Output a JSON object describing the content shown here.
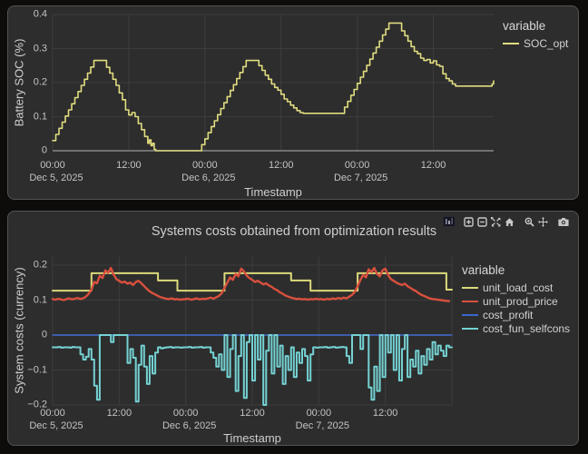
{
  "modebar": {
    "icons": [
      "plotly-logo",
      "zoom-in",
      "zoom-out",
      "autoscale",
      "reset-axes",
      "zoom",
      "pan",
      "camera"
    ]
  },
  "chart_data": [
    {
      "type": "line",
      "title": "",
      "xlabel": "Timestamp",
      "ylabel": "Battery SOC (%)",
      "legend_title": "variable",
      "legend_position": "right",
      "grid": true,
      "xlim_hours": [
        0,
        69.5
      ],
      "ylim": [
        0,
        0.4
      ],
      "x_epoch": "Dec 5, 2025 00:00",
      "x_ticks": [
        {
          "t": 0,
          "label": "00:00",
          "date": "Dec 5, 2025"
        },
        {
          "t": 12,
          "label": "12:00"
        },
        {
          "t": 24,
          "label": "00:00",
          "date": "Dec 6, 2025"
        },
        {
          "t": 36,
          "label": "12:00"
        },
        {
          "t": 48,
          "label": "00:00",
          "date": "Dec 7, 2025"
        },
        {
          "t": 60,
          "label": "12:00"
        }
      ],
      "y_ticks": [
        {
          "v": 0,
          "label": "0"
        },
        {
          "v": 0.1,
          "label": "0.1"
        },
        {
          "v": 0.2,
          "label": "0.2"
        },
        {
          "v": 0.3,
          "label": "0.3"
        },
        {
          "v": 0.4,
          "label": "0.4"
        }
      ],
      "series": [
        {
          "name": "SOC_opt",
          "color": "#e0dd80",
          "width": 1.6,
          "mode": "step",
          "points": [
            [
              0,
              0.03
            ],
            [
              0.5,
              0.048
            ],
            [
              1,
              0.066
            ],
            [
              1.5,
              0.084
            ],
            [
              2,
              0.102
            ],
            [
              2.5,
              0.12
            ],
            [
              3,
              0.138
            ],
            [
              3.5,
              0.156
            ],
            [
              4,
              0.174
            ],
            [
              4.5,
              0.192
            ],
            [
              5,
              0.21
            ],
            [
              5.5,
              0.228
            ],
            [
              6,
              0.246
            ],
            [
              6.5,
              0.265
            ],
            [
              8,
              0.265
            ],
            [
              8.5,
              0.245
            ],
            [
              9,
              0.228
            ],
            [
              9.5,
              0.21
            ],
            [
              10,
              0.192
            ],
            [
              10.5,
              0.17
            ],
            [
              11,
              0.15
            ],
            [
              11.5,
              0.12
            ],
            [
              12,
              0.105
            ],
            [
              12.5,
              0.112
            ],
            [
              13,
              0.1
            ],
            [
              13.5,
              0.08
            ],
            [
              14,
              0.062
            ],
            [
              14.5,
              0.042
            ],
            [
              15,
              0.022
            ],
            [
              15.25,
              0.032
            ],
            [
              15.5,
              0.015
            ],
            [
              15.75,
              0.022
            ],
            [
              16,
              0.004
            ],
            [
              16.25,
              0
            ],
            [
              23,
              0
            ],
            [
              23.5,
              0.018
            ],
            [
              24,
              0.035
            ],
            [
              24.5,
              0.053
            ],
            [
              25,
              0.071
            ],
            [
              25.5,
              0.088
            ],
            [
              26,
              0.106
            ],
            [
              26.5,
              0.124
            ],
            [
              27,
              0.141
            ],
            [
              27.5,
              0.159
            ],
            [
              28,
              0.177
            ],
            [
              28.5,
              0.194
            ],
            [
              29,
              0.212
            ],
            [
              29.5,
              0.23
            ],
            [
              30,
              0.247
            ],
            [
              30.5,
              0.265
            ],
            [
              32,
              0.265
            ],
            [
              32.5,
              0.25
            ],
            [
              33,
              0.236
            ],
            [
              33.5,
              0.222
            ],
            [
              34,
              0.21
            ],
            [
              34.5,
              0.196
            ],
            [
              35,
              0.186
            ],
            [
              35.5,
              0.178
            ],
            [
              36,
              0.166
            ],
            [
              36.5,
              0.152
            ],
            [
              37,
              0.144
            ],
            [
              37.5,
              0.134
            ],
            [
              38,
              0.126
            ],
            [
              38.5,
              0.118
            ],
            [
              39,
              0.112
            ],
            [
              39.5,
              0.11
            ],
            [
              45.5,
              0.11
            ],
            [
              46,
              0.128
            ],
            [
              46.5,
              0.145
            ],
            [
              47,
              0.163
            ],
            [
              47.5,
              0.18
            ],
            [
              48,
              0.198
            ],
            [
              48.5,
              0.216
            ],
            [
              49,
              0.233
            ],
            [
              49.5,
              0.251
            ],
            [
              50,
              0.269
            ],
            [
              50.5,
              0.287
            ],
            [
              51,
              0.304
            ],
            [
              51.5,
              0.322
            ],
            [
              52,
              0.34
            ],
            [
              52.5,
              0.357
            ],
            [
              53,
              0.375
            ],
            [
              54.5,
              0.375
            ],
            [
              55,
              0.352
            ],
            [
              55.5,
              0.338
            ],
            [
              56,
              0.322
            ],
            [
              56.5,
              0.306
            ],
            [
              57,
              0.292
            ],
            [
              57.5,
              0.285
            ],
            [
              58,
              0.272
            ],
            [
              58.5,
              0.265
            ],
            [
              59,
              0.268
            ],
            [
              59.5,
              0.258
            ],
            [
              60,
              0.264
            ],
            [
              60.5,
              0.252
            ],
            [
              61,
              0.248
            ],
            [
              61.5,
              0.226
            ],
            [
              62,
              0.212
            ],
            [
              62.5,
              0.205
            ],
            [
              63,
              0.196
            ],
            [
              63.5,
              0.19
            ],
            [
              69,
              0.19
            ],
            [
              69.25,
              0.196
            ],
            [
              69.5,
              0.205
            ]
          ]
        }
      ]
    },
    {
      "type": "line",
      "title": "Systems costs obtained from optimization results",
      "xlabel": "Timestamp",
      "ylabel": "System costs (currency)",
      "legend_title": "variable",
      "legend_position": "right",
      "grid": true,
      "xlim_hours": [
        0,
        72
      ],
      "ylim": [
        -0.2,
        0.22
      ],
      "x_epoch": "Dec 5, 2025 00:00",
      "x_ticks": [
        {
          "t": 0,
          "label": "00:00",
          "date": "Dec 5, 2025"
        },
        {
          "t": 12,
          "label": "12:00"
        },
        {
          "t": 24,
          "label": "00:00",
          "date": "Dec 6, 2025"
        },
        {
          "t": 36,
          "label": "12:00"
        },
        {
          "t": 48,
          "label": "00:00",
          "date": "Dec 7, 2025"
        },
        {
          "t": 60,
          "label": "12:00"
        }
      ],
      "y_ticks": [
        {
          "v": -0.2,
          "label": "−0.2"
        },
        {
          "v": -0.1,
          "label": "−0.1"
        },
        {
          "v": 0,
          "label": "0"
        },
        {
          "v": 0.1,
          "label": "0.1"
        },
        {
          "v": 0.2,
          "label": "0.2"
        }
      ],
      "series": [
        {
          "name": "unit_load_cost",
          "color": "#dcd97b",
          "width": 2,
          "mode": "step",
          "points": [
            [
              0,
              0.127
            ],
            [
              7,
              0.177
            ],
            [
              19,
              0.156
            ],
            [
              22.5,
              0.127
            ],
            [
              31,
              0.177
            ],
            [
              43,
              0.156
            ],
            [
              46.5,
              0.127
            ],
            [
              55,
              0.177
            ],
            [
              71,
              0.13
            ],
            [
              72,
              0.13
            ]
          ]
        },
        {
          "name": "unit_prod_price",
          "color": "#d9503e",
          "width": 2.4,
          "mode": "linear",
          "t0": 0,
          "dt": 0.5,
          "values": [
            0.103,
            0.101,
            0.104,
            0.102,
            0.1,
            0.103,
            0.105,
            0.102,
            0.104,
            0.106,
            0.103,
            0.105,
            0.11,
            0.118,
            0.13,
            0.152,
            0.148,
            0.17,
            0.163,
            0.185,
            0.178,
            0.192,
            0.173,
            0.16,
            0.155,
            0.15,
            0.153,
            0.147,
            0.15,
            0.143,
            0.152,
            0.155,
            0.148,
            0.14,
            0.132,
            0.125,
            0.12,
            0.116,
            0.112,
            0.108,
            0.106,
            0.104,
            0.103,
            0.105,
            0.102,
            0.103,
            0.101,
            0.102,
            0.103,
            0.104,
            0.101,
            0.103,
            0.105,
            0.102,
            0.104,
            0.103,
            0.105,
            0.107,
            0.104,
            0.108,
            0.112,
            0.12,
            0.135,
            0.15,
            0.165,
            0.158,
            0.175,
            0.168,
            0.19,
            0.182,
            0.17,
            0.163,
            0.158,
            0.152,
            0.155,
            0.15,
            0.145,
            0.148,
            0.142,
            0.138,
            0.132,
            0.128,
            0.122,
            0.118,
            0.113,
            0.11,
            0.107,
            0.105,
            0.103,
            0.104,
            0.102,
            0.103,
            0.101,
            0.103,
            0.102,
            0.104,
            0.102,
            0.103,
            0.101,
            0.104,
            0.102,
            0.105,
            0.103,
            0.106,
            0.104,
            0.107,
            0.105,
            0.11,
            0.115,
            0.124,
            0.14,
            0.158,
            0.172,
            0.165,
            0.188,
            0.18,
            0.192,
            0.175,
            0.168,
            0.185,
            0.19,
            0.172,
            0.16,
            0.155,
            0.15,
            0.146,
            0.143,
            0.147,
            0.14,
            0.135,
            0.13,
            0.126,
            0.12,
            0.115,
            0.112,
            0.108,
            0.105,
            0.103,
            0.102,
            0.101,
            0.1,
            0.099,
            0.098,
            0.097
          ]
        },
        {
          "name": "cost_profit",
          "color": "#3a66cc",
          "width": 1.4,
          "mode": "linear",
          "points": [
            [
              0,
              0
            ],
            [
              72,
              0
            ]
          ]
        },
        {
          "name": "cost_fun_selfcons",
          "color": "#75d2d3",
          "width": 2,
          "mode": "step",
          "t0": 0,
          "dt": 0.5,
          "values": [
            -0.035,
            -0.035,
            -0.034,
            -0.036,
            -0.035,
            -0.035,
            -0.036,
            -0.034,
            -0.035,
            -0.035,
            -0.055,
            -0.07,
            -0.062,
            -0.04,
            -0.07,
            -0.145,
            -0.185,
            0,
            0,
            0,
            0,
            -0.02,
            0,
            0,
            0,
            0,
            0,
            -0.08,
            -0.04,
            -0.065,
            -0.19,
            -0.085,
            -0.03,
            -0.09,
            -0.14,
            -0.06,
            -0.11,
            -0.05,
            -0.035,
            -0.038,
            -0.036,
            -0.035,
            -0.034,
            -0.036,
            -0.035,
            -0.035,
            -0.036,
            -0.035,
            -0.035,
            -0.034,
            -0.036,
            -0.035,
            -0.035,
            -0.034,
            -0.036,
            -0.035,
            -0.035,
            -0.05,
            -0.065,
            -0.09,
            -0.055,
            -0.1,
            0,
            -0.12,
            -0.04,
            0,
            -0.16,
            -0.06,
            0,
            -0.18,
            -0.02,
            0,
            -0.13,
            0,
            -0.07,
            0,
            -0.2,
            -0.045,
            0,
            -0.11,
            0,
            -0.09,
            -0.03,
            -0.14,
            -0.06,
            -0.1,
            -0.035,
            -0.12,
            -0.05,
            -0.08,
            -0.04,
            -0.06,
            -0.13,
            -0.055,
            -0.035,
            -0.036,
            -0.035,
            -0.035,
            -0.034,
            -0.036,
            -0.035,
            -0.034,
            -0.036,
            -0.035,
            -0.034,
            -0.035,
            -0.06,
            -0.08,
            0,
            0,
            0,
            -0.04,
            0,
            0,
            -0.15,
            -0.185,
            -0.09,
            -0.16,
            0,
            -0.12,
            0,
            -0.05,
            0,
            -0.1,
            0,
            -0.13,
            -0.04,
            0,
            -0.12,
            -0.07,
            -0.09,
            -0.045,
            -0.11,
            -0.06,
            -0.085,
            -0.04,
            -0.07,
            -0.02,
            -0.055,
            -0.03,
            -0.045,
            -0.06,
            -0.03,
            -0.035
          ]
        }
      ]
    }
  ]
}
